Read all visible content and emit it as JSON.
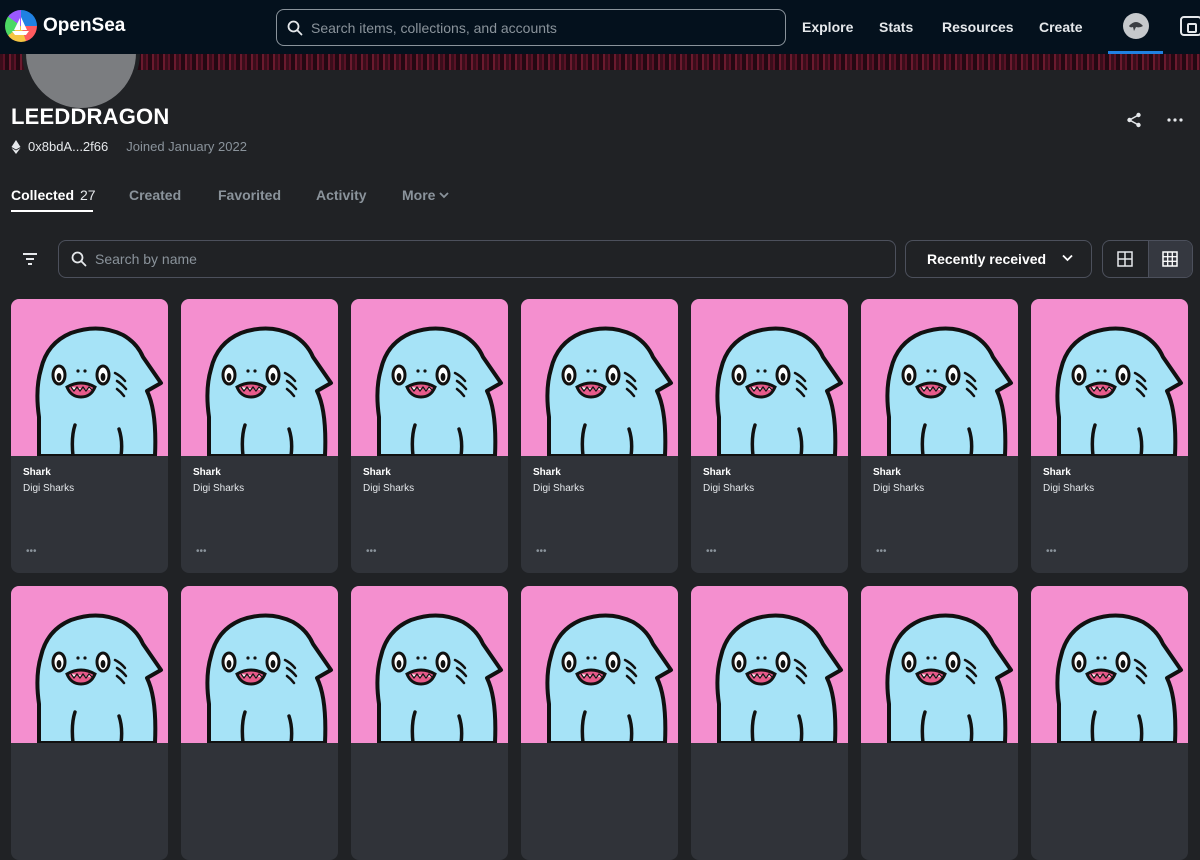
{
  "nav": {
    "logo_text": "OpenSea",
    "search_placeholder": "Search items, collections, and accounts",
    "links": [
      "Explore",
      "Stats",
      "Resources",
      "Create"
    ]
  },
  "profile": {
    "username": "LEEDDRAGON",
    "address": "0x8bdA...2f66",
    "joined": "Joined January 2022"
  },
  "tabs": {
    "collected_label": "Collected",
    "collected_count": "27",
    "created_label": "Created",
    "favorited_label": "Favorited",
    "activity_label": "Activity",
    "more_label": "More"
  },
  "filters": {
    "search_placeholder": "Search by name",
    "sort_value": "Recently received"
  },
  "items": [
    {
      "name": "Shark",
      "collection": "Digi Sharks"
    },
    {
      "name": "Shark",
      "collection": "Digi Sharks"
    },
    {
      "name": "Shark",
      "collection": "Digi Sharks"
    },
    {
      "name": "Shark",
      "collection": "Digi Sharks"
    },
    {
      "name": "Shark",
      "collection": "Digi Sharks"
    },
    {
      "name": "Shark",
      "collection": "Digi Sharks"
    },
    {
      "name": "Shark",
      "collection": "Digi Sharks"
    },
    {
      "name": "",
      "collection": ""
    },
    {
      "name": "",
      "collection": ""
    },
    {
      "name": "",
      "collection": ""
    },
    {
      "name": "",
      "collection": ""
    },
    {
      "name": "",
      "collection": ""
    },
    {
      "name": "",
      "collection": ""
    },
    {
      "name": "",
      "collection": ""
    }
  ],
  "card_more_label": "•••",
  "colors": {
    "nav_bg": "#04111d",
    "page_bg": "#202225",
    "card_bg": "#303339",
    "art_bg": "#f48fcf",
    "shark_body": "#a6e3f7",
    "accent": "#2081e2"
  }
}
